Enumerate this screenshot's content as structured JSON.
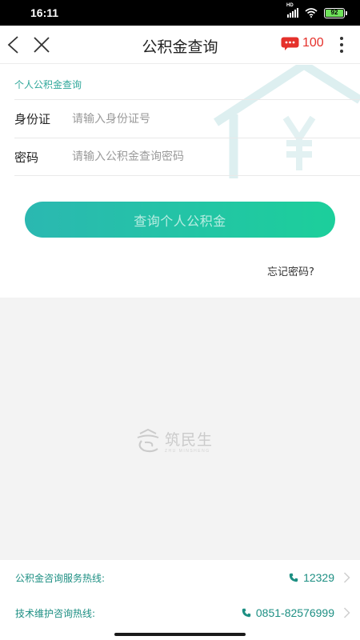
{
  "status_bar": {
    "time": "16:11",
    "signal_label": "HD",
    "battery_level": "92",
    "icons": [
      "signal-icon",
      "wifi-icon",
      "battery-icon"
    ]
  },
  "nav": {
    "title": "公积金查询",
    "message_count": "100",
    "icons": [
      "back-icon",
      "close-icon",
      "message-icon",
      "more-icon"
    ],
    "accent_color": "#e5312b"
  },
  "form": {
    "section_title": "个人公积金查询",
    "id_label": "身份证",
    "id_placeholder": "请输入身份证号",
    "password_label": "密码",
    "password_placeholder": "请输入公积金查询密码",
    "submit_label": "查询个人公积金",
    "forgot_label": "忘记密码?",
    "watermark_icon": "house-yen-icon"
  },
  "brand": {
    "logo_icon": "zhumingsheng-logo-icon",
    "name_cn": "筑民生",
    "name_en": "ZHU MINSHENG"
  },
  "hotlines": [
    {
      "label": "公积金咨询服务热线:",
      "number": "12329"
    },
    {
      "label": "技术维护咨询热线:",
      "number": "0851-82576999"
    }
  ],
  "colors": {
    "primary_gradient_start": "#2bb8b1",
    "primary_gradient_end": "#1ccf9b",
    "link_teal": "#1d8f83",
    "background_gray": "#f3f3f3"
  }
}
